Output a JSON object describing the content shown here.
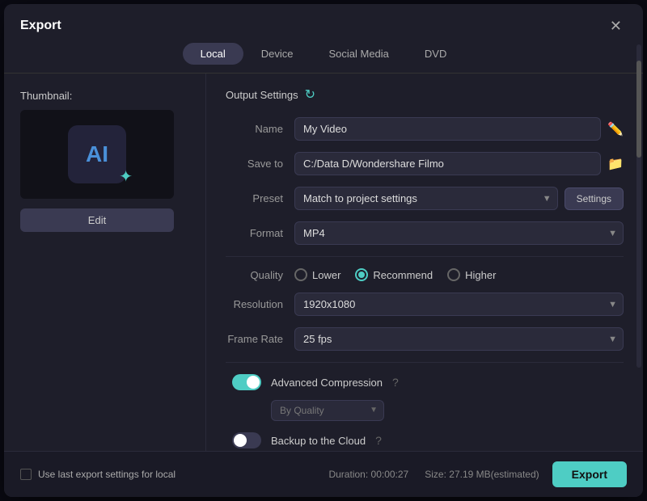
{
  "dialog": {
    "title": "Export",
    "close_label": "✕"
  },
  "tabs": [
    {
      "id": "local",
      "label": "Local",
      "active": true
    },
    {
      "id": "device",
      "label": "Device",
      "active": false
    },
    {
      "id": "social-media",
      "label": "Social Media",
      "active": false
    },
    {
      "id": "dvd",
      "label": "DVD",
      "active": false
    }
  ],
  "left_panel": {
    "thumbnail_label": "Thumbnail:",
    "edit_label": "Edit"
  },
  "right_panel": {
    "section_title": "Output Settings",
    "name_label": "Name",
    "name_value": "My Video",
    "save_to_label": "Save to",
    "save_to_value": "C:/Data D/Wondershare Filmo",
    "preset_label": "Preset",
    "preset_value": "Match to project settings",
    "settings_btn_label": "Settings",
    "format_label": "Format",
    "format_value": "MP4",
    "quality_label": "Quality",
    "quality_options": [
      {
        "id": "lower",
        "label": "Lower",
        "checked": false
      },
      {
        "id": "recommend",
        "label": "Recommend",
        "checked": true
      },
      {
        "id": "higher",
        "label": "Higher",
        "checked": false
      }
    ],
    "resolution_label": "Resolution",
    "resolution_value": "1920x1080",
    "frame_rate_label": "Frame Rate",
    "frame_rate_value": "25 fps",
    "advanced_compression_label": "Advanced Compression",
    "advanced_compression_on": true,
    "quality_select_value": "By Quality",
    "backup_cloud_label": "Backup to the Cloud",
    "backup_cloud_on": false
  },
  "bottom_bar": {
    "use_last_label": "Use last export settings for local",
    "duration_label": "Duration:",
    "duration_value": "00:00:27",
    "size_label": "Size:",
    "size_value": "27.19 MB(estimated)",
    "export_label": "Export"
  }
}
